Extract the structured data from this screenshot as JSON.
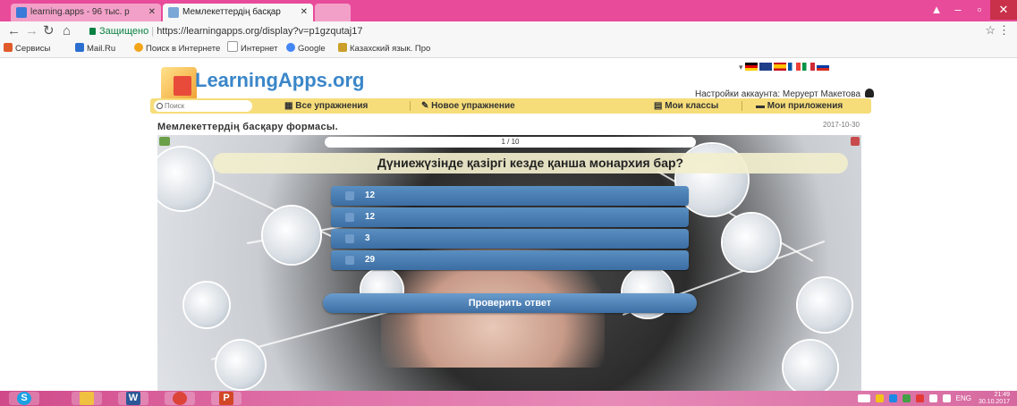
{
  "browser": {
    "tabs": [
      {
        "title": "learning.apps - 96 тыс. р"
      },
      {
        "title": "Мемлекеттердің басқар"
      }
    ],
    "address": {
      "secure_label": "Защищено",
      "url": "https://learningapps.org/display?v=p1gzqutaj17"
    },
    "bookmarks": [
      {
        "label": "Сервисы"
      },
      {
        "label": "Mail.Ru"
      },
      {
        "label": "Поиск в Интернете"
      },
      {
        "label": "Интернет"
      },
      {
        "label": "Google"
      },
      {
        "label": "Казахский язык. Про"
      }
    ]
  },
  "site": {
    "logo": "LearningApps.org",
    "account": "Настройки аккаунта: Меруерт Макетова",
    "search_placeholder": "Поиск",
    "nav": {
      "all_exercises": "Все упражнения",
      "new_exercise": "Новое упражнение",
      "my_classes": "Мои классы",
      "my_apps": "Мои приложения"
    },
    "page_title": "Мемлекеттердің басқару формасы.",
    "date": "2017-10-30"
  },
  "quiz": {
    "progress": "1 / 10",
    "question": "Дүниежүзінде қазіргі кезде қанша монархия бар?",
    "answers": [
      "12",
      "12",
      "3",
      "29"
    ],
    "check_button": "Проверить ответ"
  },
  "taskbar": {
    "language": "ENG",
    "time": "21:49",
    "date": "30.10.2017"
  }
}
